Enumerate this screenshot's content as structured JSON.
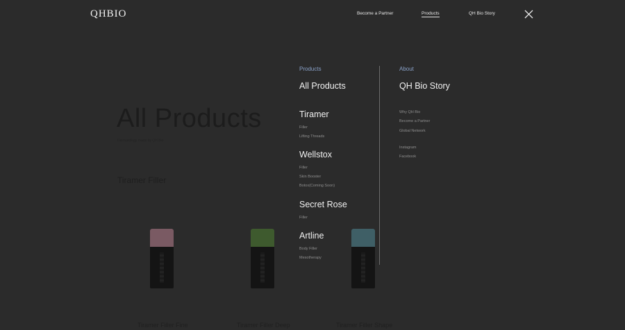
{
  "logo": "QHBIO",
  "topnav": {
    "items": [
      "Become a Partner",
      "Products",
      "QH Bio Story"
    ],
    "active": "Products"
  },
  "background": {
    "title": "All Products",
    "subtitle": "Dermatology made by QH Bio",
    "section": "Tiramer Filler",
    "products": [
      {
        "name": "Tiramer Filler Fine",
        "cap_color": "#7a5a63"
      },
      {
        "name": "Tiramer Filler Deep",
        "cap_color": "#3e5a2e"
      },
      {
        "name": "Tiramer Filler Shape",
        "cap_color": "#3f5f66"
      }
    ]
  },
  "menu": {
    "products": {
      "heading": "Products",
      "all": "All Products",
      "groups": [
        {
          "title": "Tiramer",
          "items": [
            "Filler",
            "Lifting Threads"
          ]
        },
        {
          "title": "Wellstox",
          "items": [
            "Filler",
            "Skin Booster",
            "Botox(Coming Soon)"
          ]
        },
        {
          "title": "Secret Rose",
          "items": [
            "Filler"
          ]
        },
        {
          "title": "Artline",
          "items": [
            "Body Filler",
            "Mesotherapy"
          ]
        }
      ]
    },
    "about": {
      "heading": "About",
      "story": "QH Bio Story",
      "links": [
        "Why QH Bio",
        "Become a Partner",
        "Global Network"
      ],
      "social": [
        "Instagram",
        "Facebook"
      ]
    }
  },
  "colors": {
    "overlay_bg": "#2a2a2a",
    "heading_accent": "#8aa2c9",
    "text_primary": "#f2f2f2",
    "text_secondary": "#8f8f8f"
  },
  "icons": {
    "close": "close-icon"
  }
}
